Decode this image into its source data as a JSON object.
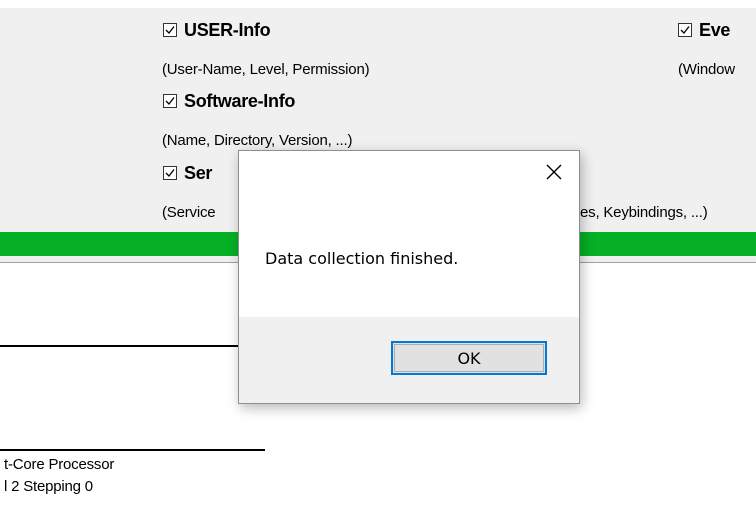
{
  "options": {
    "user_info": {
      "label": "USER-Info",
      "desc": "(User-Name, Level, Permission)",
      "checked": true
    },
    "software_info": {
      "label": "Software-Info",
      "desc": "(Name, Directory, Version, ...)",
      "checked": true
    },
    "services_info": {
      "label": "Ser",
      "desc": "(Service",
      "checked": true
    },
    "events_info": {
      "label": "Eve",
      "desc": "(Window",
      "checked": true
    },
    "hidden_desc_tail": "es, Keybindings, ...)"
  },
  "progress": {
    "percent": 100,
    "color": "#06b025"
  },
  "details": {
    "line1": "t-Core Processor",
    "line2": "l 2 Stepping 0"
  },
  "dialog": {
    "message": "Data collection finished.",
    "ok_label": "OK",
    "close_symbol": "✕"
  },
  "colors": {
    "accent": "#0078d7",
    "panel": "#f0f0f0"
  }
}
